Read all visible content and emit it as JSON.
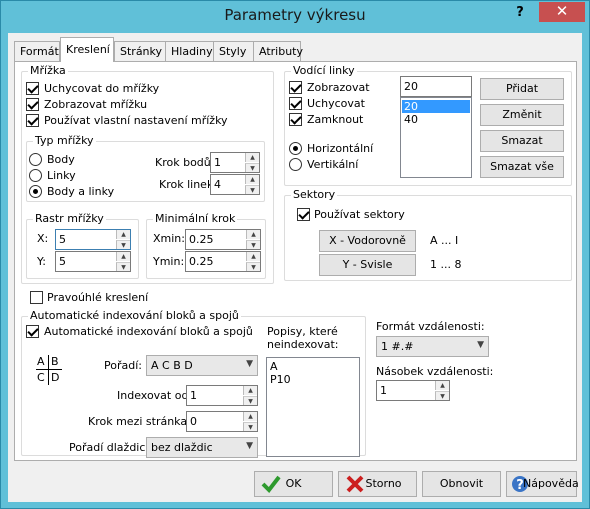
{
  "window": {
    "title": "Parametry výkresu",
    "help_glyph": "?",
    "close_glyph": "✕"
  },
  "tabs": [
    "Formát",
    "Kreslení",
    "Stránky",
    "Hladiny",
    "Styly",
    "Atributy"
  ],
  "mrizka": {
    "title": "Mřížka",
    "snap": "Uchycovat do mřížky",
    "show": "Zobrazovat mřížku",
    "own": "Používat vlastní nastavení mřížky",
    "typ": {
      "title": "Typ mřížky",
      "opts": [
        "Body",
        "Linky",
        "Body a linky"
      ],
      "krok_bodu_label": "Krok bodů",
      "krok_bodu": "1",
      "krok_linek_label": "Krok linek",
      "krok_linek": "4"
    },
    "rastr": {
      "title": "Rastr mřížky",
      "x_label": "X:",
      "x": "5",
      "y_label": "Y:",
      "y": "5"
    },
    "minkrok": {
      "title": "Minimální krok",
      "xmin_label": "Xmin:",
      "xmin": "0.25",
      "ymin_label": "Ymin:",
      "ymin": "0.25"
    }
  },
  "vodici": {
    "title": "Vodící linky",
    "show": "Zobrazovat",
    "snap": "Uchycovat",
    "lock": "Zamknout",
    "horiz": "Horizontální",
    "vert": "Vertikální",
    "input": "20",
    "list": [
      "20",
      "40"
    ],
    "add": "Přidat",
    "change": "Změnit",
    "delete": "Smazat",
    "delete_all": "Smazat vše"
  },
  "sektory": {
    "title": "Sektory",
    "use": "Používat sektory",
    "x_btn": "X - Vodorovně",
    "x_range": "A ... I",
    "y_btn": "Y - Svisle",
    "y_range": "1 ... 8"
  },
  "pravouhle": "Pravoúhlé kreslení",
  "auto": {
    "title": "Automatické indexování bloků a spojů",
    "check": "Automatické indexování bloků a spojů",
    "poradi_label": "Pořadí:",
    "poradi": "A C B D",
    "od_label": "Indexovat od:",
    "od": "1",
    "krok_label": "Krok mezi stránkami:",
    "krok": "0",
    "dlazdic_label": "Pořadí dlaždic:",
    "dlazdic": "bez dlaždic",
    "popisy_label": "Popisy, které neindexovat:",
    "popisy": [
      "A",
      "P10"
    ],
    "icon_letters": [
      "A",
      "B",
      "C",
      "D"
    ]
  },
  "format": {
    "label": "Formát vzdálenosti:",
    "value": "1 #.#",
    "nasobek_label": "Násobek vzdálenosti:",
    "nasobek": "1"
  },
  "buttons": {
    "ok": "OK",
    "cancel": "Storno",
    "refresh": "Obnovit",
    "help": "Nápověda"
  },
  "colors": {
    "title_bar": "#60c0d8",
    "close": "#c75050",
    "selection": "#3399ff"
  }
}
